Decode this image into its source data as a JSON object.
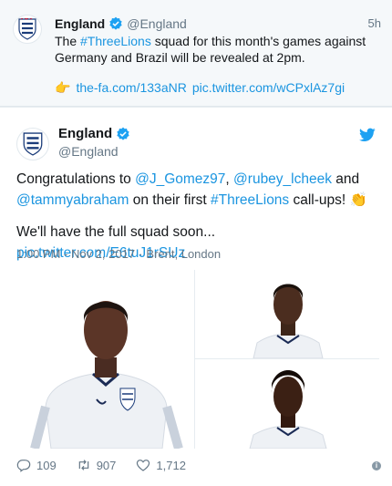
{
  "top_tweet": {
    "name": "England",
    "handle": "@England",
    "time": "5h",
    "text_parts": {
      "pre": "The ",
      "hashtag": "#ThreeLions",
      "post": " squad for this month's games against Germany and Brazil will be revealed at 2pm."
    },
    "emoji": "👉",
    "link1": "the-fa.com/133aNR",
    "link2": "pic.twitter.com/wCPxlAz7gi"
  },
  "main_tweet": {
    "name": "England",
    "handle": "@England",
    "text": {
      "t1": "Congratulations to ",
      "m1": "@J_Gomez97",
      "t2": ", ",
      "m2": "@rubey_lcheek",
      "t3": " and ",
      "m3": "@tammyabraham",
      "t4": " on their first ",
      "hashtag": "#ThreeLions",
      "t5": " call-ups! ",
      "emoji": "👏",
      "line2": "We'll have the full squad soon... ",
      "link": "pic.twitter.com/E6tuJ1rSUz"
    },
    "timestamp": "1:00 PM - Nov 2, 2017",
    "separator": "·",
    "location": "Brent, London",
    "actions": {
      "replies": "109",
      "retweets": "907",
      "likes": "1,712"
    },
    "info_label": "i"
  },
  "icons": {
    "verified": "verified-badge-icon",
    "bird": "twitter-bird-icon",
    "reply": "reply-icon",
    "retweet": "retweet-icon",
    "like": "heart-icon"
  },
  "colors": {
    "link": "#1b95e0",
    "muted": "#657786",
    "background": "#e6ecf0"
  }
}
